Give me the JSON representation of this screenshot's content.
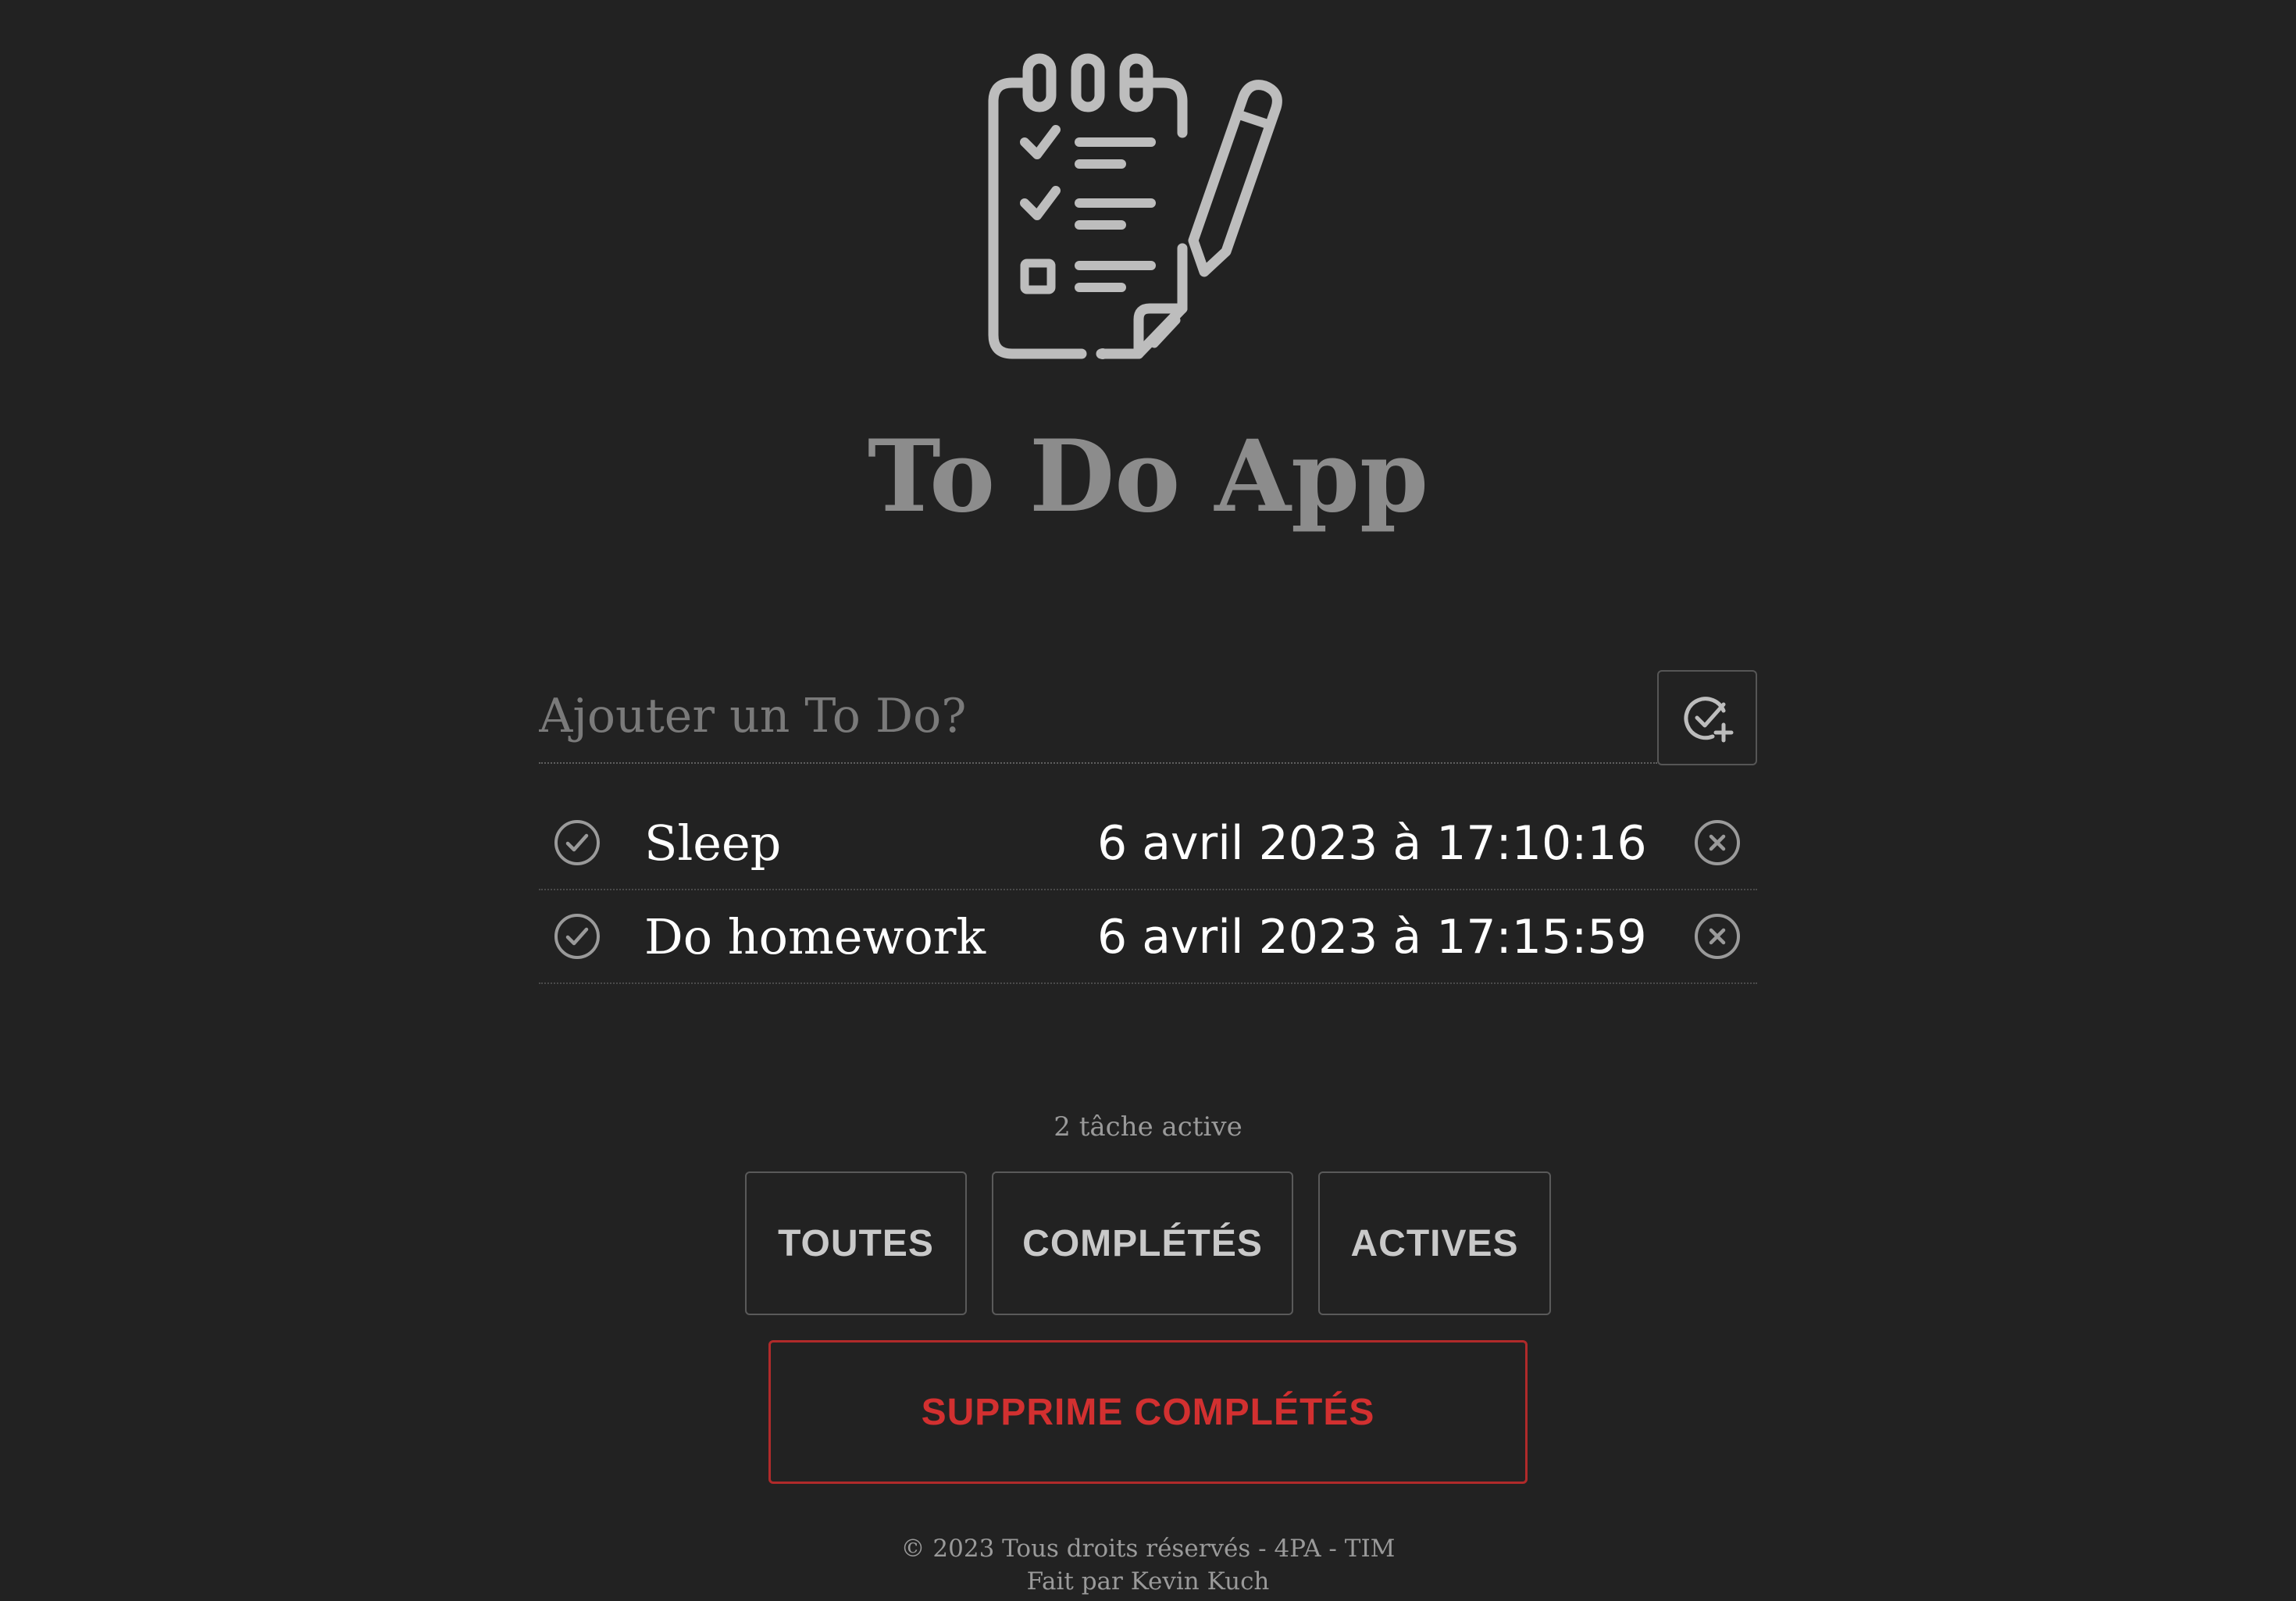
{
  "header": {
    "logo_icon": "clipboard-checklist-icon",
    "title": "To Do App"
  },
  "form": {
    "input_value": "",
    "input_placeholder": "Ajouter un To Do?",
    "add_button_icon": "check-circle-plus-icon"
  },
  "todos": [
    {
      "text": "Sleep",
      "date": "6 avril 2023 à 17:10:16",
      "completed": false
    },
    {
      "text": "Do homework",
      "date": "6 avril 2023 à 17:15:59",
      "completed": false
    }
  ],
  "counter": "2 tâche active",
  "filters": {
    "all": "TOUTES",
    "completed": "COMPLÉTÉS",
    "active": "ACTIVES"
  },
  "clear_completed": "SUPPRIME COMPLÉTÉS",
  "footer": {
    "line1": "© 2023 Tous droits réservés - 4PA - TIM",
    "line2": "Fait par Kevin Kuch"
  },
  "colors": {
    "background": "#222222",
    "title": "#8c8c8c",
    "icon": "#bdbdbd",
    "danger": "#d23030"
  }
}
